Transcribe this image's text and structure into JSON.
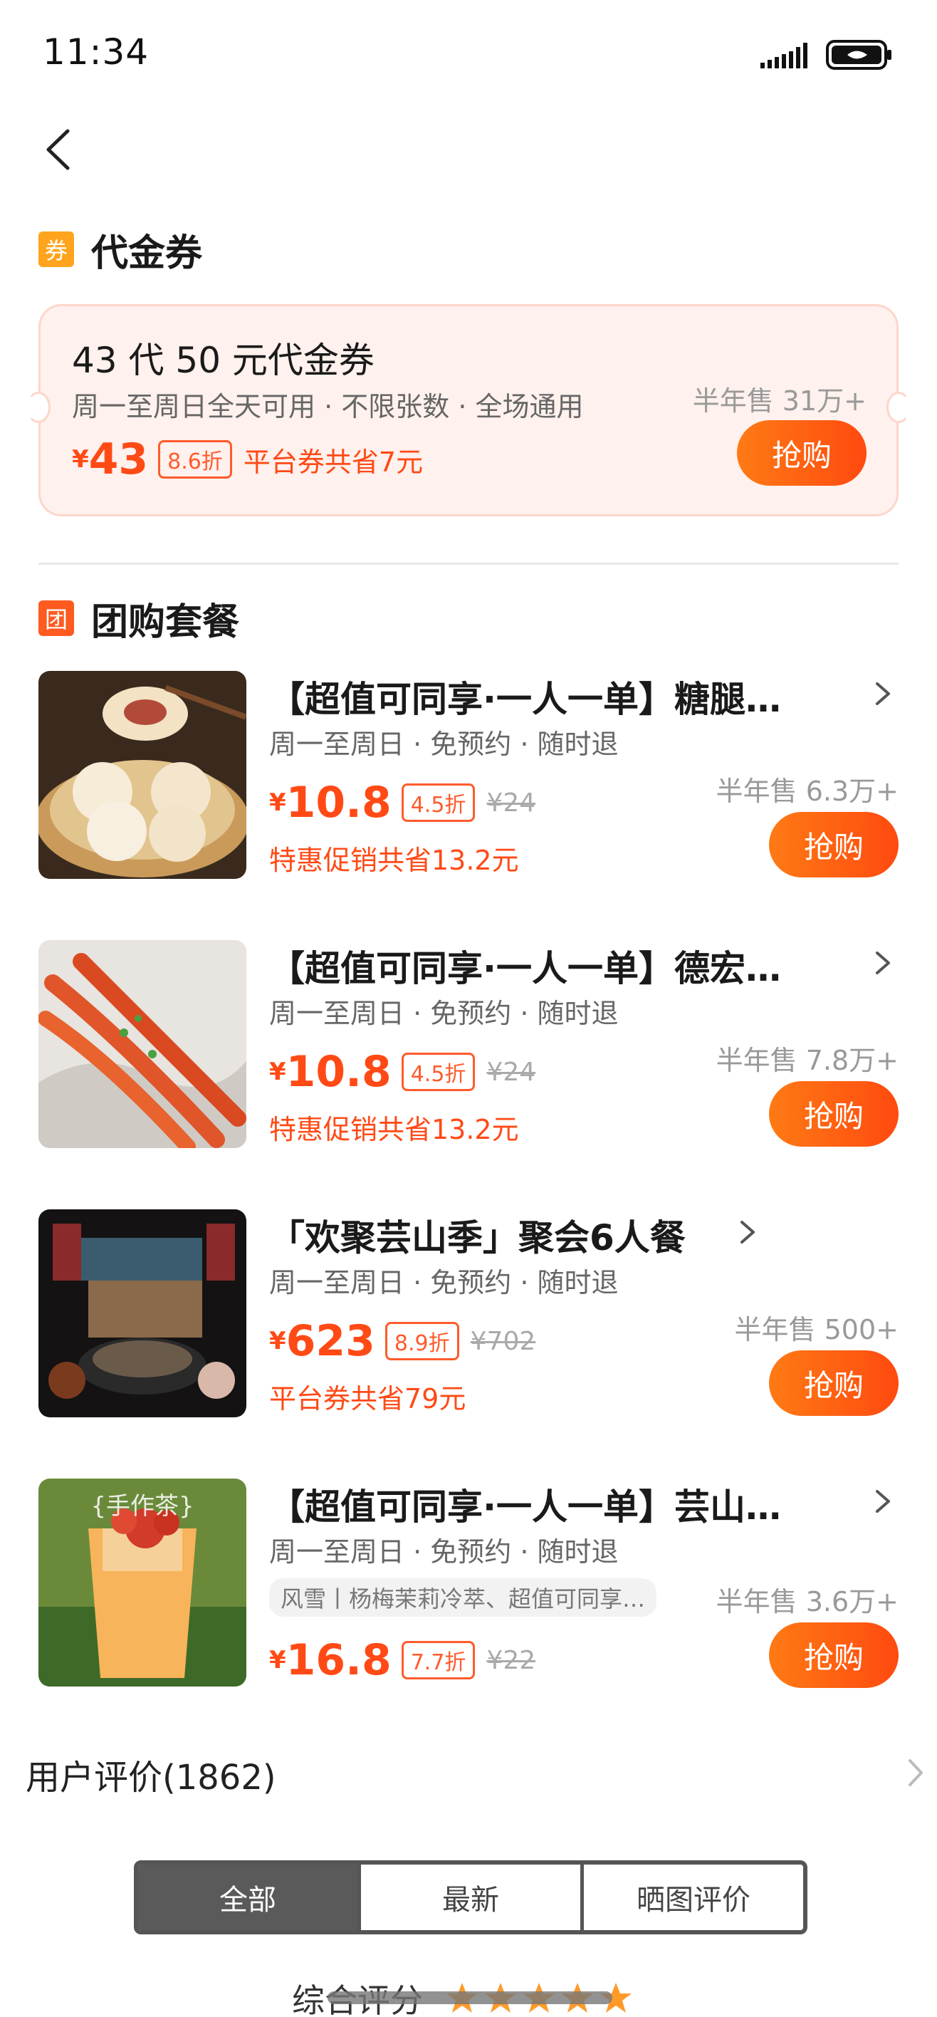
{
  "status_bar": {
    "time": "11:34"
  },
  "voucher_section": {
    "icon_text": "券",
    "title": "代金券",
    "card": {
      "title": "43 代 50 元代金券",
      "tags": "周一至周日全天可用 · 不限张数 · 全场通用",
      "yen": "¥",
      "price": "43",
      "discount": "8.6折",
      "save": "平台券共省7元",
      "sold": "半年售 31万+",
      "buy": "抢购"
    }
  },
  "group_section": {
    "icon_text": "团",
    "title": "团购套餐",
    "deals": [
      {
        "title": "【超值可同享·一人一单】糖腿…",
        "tags": "周一至周日 · 免预约 · 随时退",
        "yen": "¥",
        "price": "10.8",
        "discount": "4.5折",
        "original": "¥24",
        "save": "特惠促销共省13.2元",
        "sold": "半年售 6.3万+",
        "buy": "抢购"
      },
      {
        "title": "【超值可同享·一人一单】德宏…",
        "tags": "周一至周日 · 免预约 · 随时退",
        "yen": "¥",
        "price": "10.8",
        "discount": "4.5折",
        "original": "¥24",
        "save": "特惠促销共省13.2元",
        "sold": "半年售 7.8万+",
        "buy": "抢购"
      },
      {
        "title": "「欢聚芸山季」聚会6人餐",
        "tags": "周一至周日 · 免预约 · 随时退",
        "yen": "¥",
        "price": "623",
        "discount": "8.9折",
        "original": "¥702",
        "save": "平台券共省79元",
        "sold": "半年售 500+",
        "buy": "抢购"
      },
      {
        "title": "【超值可同享·一人一单】芸山…",
        "tags": "周一至周日 · 免预约 · 随时退",
        "note": "风雪丨杨梅茉莉冷萃、超值可同享…",
        "yen": "¥",
        "price": "16.8",
        "discount": "7.7折",
        "original": "¥22",
        "sold": "半年售 3.6万+",
        "buy": "抢购",
        "image_text": "{手作茶}"
      }
    ]
  },
  "reviews": {
    "title": "用户评价(1862)",
    "tabs": [
      "全部",
      "最新",
      "晒图评价"
    ],
    "overall_label": "综合评分"
  },
  "colors": {
    "accent": "#ff4a16",
    "button_start": "#ff7a14",
    "button_end": "#ff4a10"
  }
}
